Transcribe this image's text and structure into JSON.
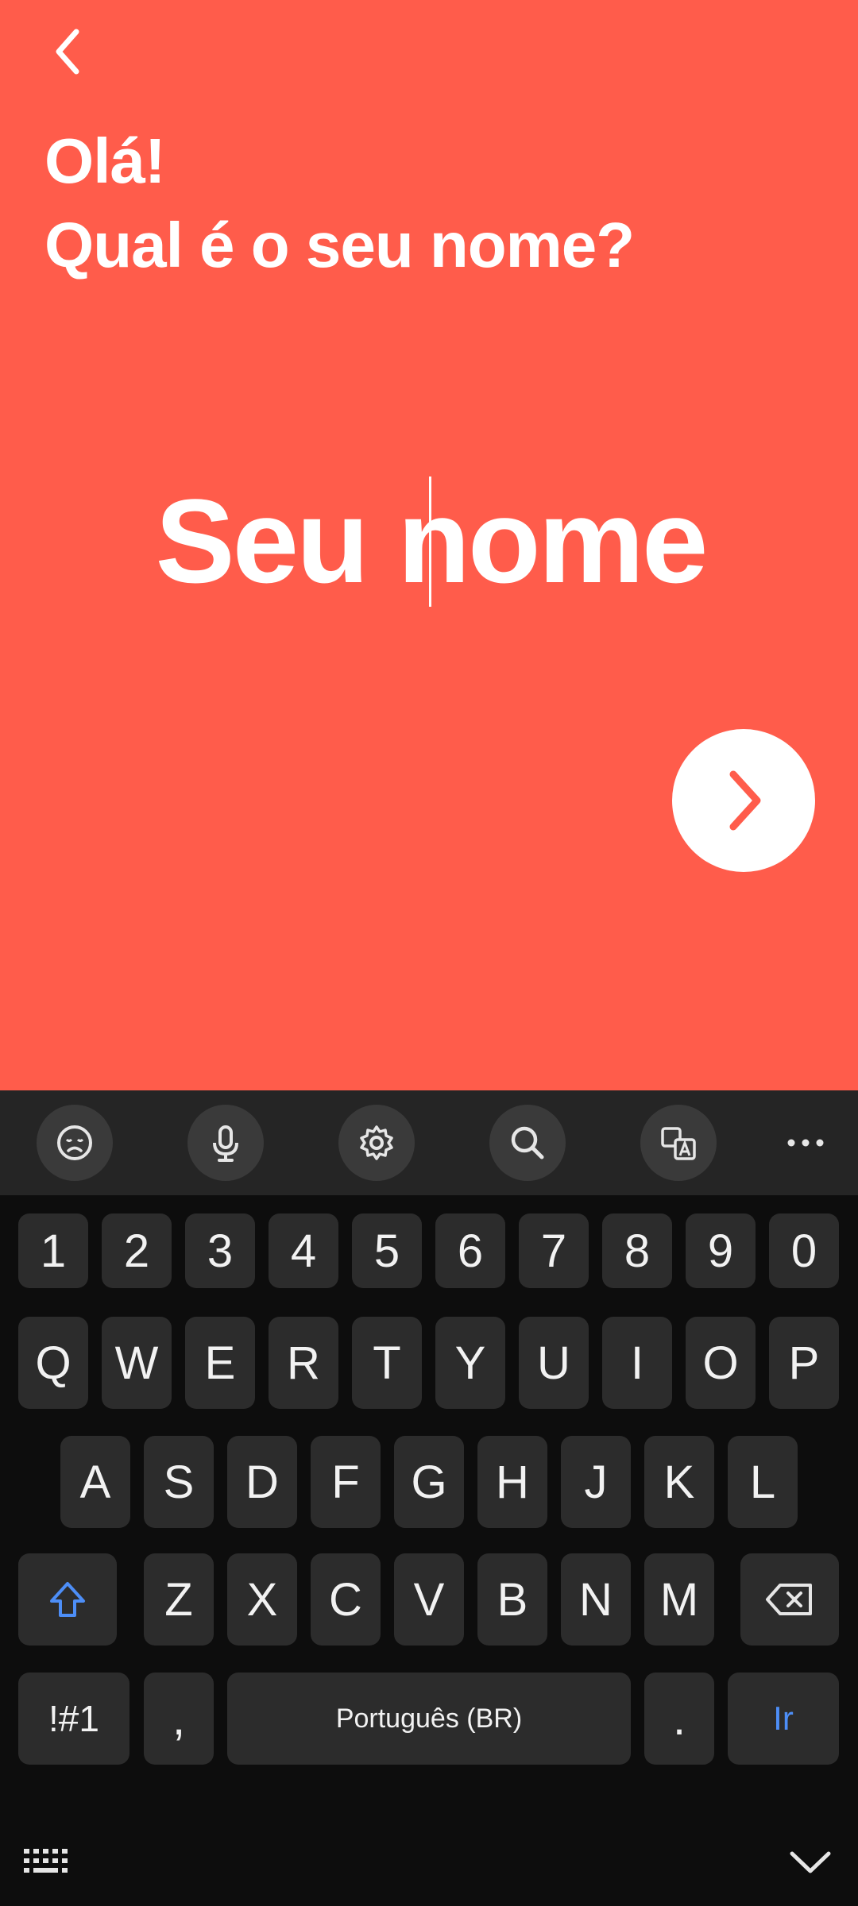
{
  "header": {
    "line1": "Olá!",
    "line2": "Qual é o seu nome?"
  },
  "name_field": {
    "placeholder": "Seu nome",
    "value": ""
  },
  "icons": {
    "back": "chevron-left-icon",
    "next": "chevron-right-icon"
  },
  "colors": {
    "background": "#FF5C4B",
    "accent_key": "#4d8ef7",
    "keyboard_bg": "#0d0d0d"
  },
  "keyboard": {
    "toolbar": [
      "emoji-icon",
      "microphone-icon",
      "settings-icon",
      "search-icon",
      "translate-icon",
      "more-icon"
    ],
    "row_numbers": [
      "1",
      "2",
      "3",
      "4",
      "5",
      "6",
      "7",
      "8",
      "9",
      "0"
    ],
    "row_q": [
      "Q",
      "W",
      "E",
      "R",
      "T",
      "Y",
      "U",
      "I",
      "O",
      "P"
    ],
    "row_a": [
      "A",
      "S",
      "D",
      "F",
      "G",
      "H",
      "J",
      "K",
      "L"
    ],
    "row_z": [
      "Z",
      "X",
      "C",
      "V",
      "B",
      "N",
      "M"
    ],
    "symbols": "!#1",
    "comma": ",",
    "space": "Português (BR)",
    "period": ".",
    "go": "Ir"
  }
}
